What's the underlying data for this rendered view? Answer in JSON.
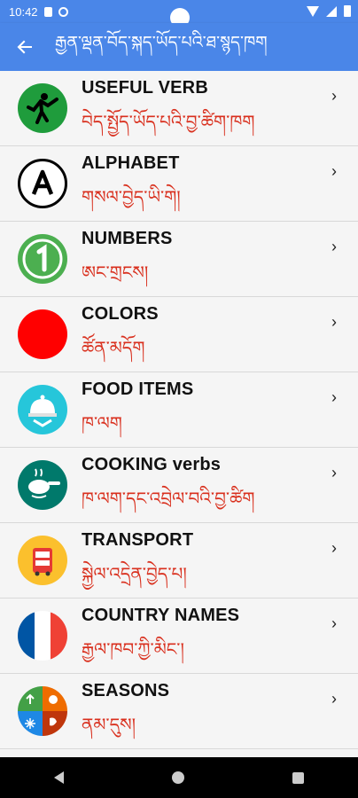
{
  "status": {
    "time": "10:42"
  },
  "appbar": {
    "back_icon": "arrow-left-icon",
    "title": "རྒྱན་ལྡན་བོད་སྐད་ཡོད་པའི་ཐ་སྙད་ཁག"
  },
  "items": [
    {
      "en": "USEFUL VERB",
      "bo": "བེད་སྤྱོད་ཡོད་པའི་བྱ་ཚིག་ཁག",
      "icon": "kick-person-icon",
      "color": "#1f9c3c"
    },
    {
      "en": "ALPHABET",
      "bo": "གསལ་བྱེད་ཡི་གེ།",
      "icon": "letter-a-icon",
      "color": "#ffffff"
    },
    {
      "en": "NUMBERS",
      "bo": "ཨང་གྲངས།",
      "icon": "number-one-icon",
      "color": "#4caf50"
    },
    {
      "en": "COLORS",
      "bo": "ཚོན་མདོག",
      "icon": "red-circle-icon",
      "color": "#ff0000"
    },
    {
      "en": "FOOD ITEMS",
      "bo": "ཁ་ལག",
      "icon": "food-cloche-icon",
      "color": "#26c6da"
    },
    {
      "en": "COOKING verbs",
      "bo": "ཁ་ལག་དང་འབྲེལ་བའི་བྱ་ཚིག",
      "icon": "frying-pan-icon",
      "color": "#00796b"
    },
    {
      "en": "TRANSPORT",
      "bo": "སྐྱེལ་འདྲེན་བྱེད་པ།",
      "icon": "bus-icon",
      "color": "#fbc02d"
    },
    {
      "en": "COUNTRY NAMES",
      "bo": "རྒྱལ་ཁབ་ཀྱི་མིང་།",
      "icon": "french-flag-icon",
      "color": "#0055a4"
    },
    {
      "en": "SEASONS",
      "bo": "ནམ་དུས།",
      "icon": "seasons-icon",
      "color": "#ef6c00"
    }
  ],
  "chevron": "›"
}
